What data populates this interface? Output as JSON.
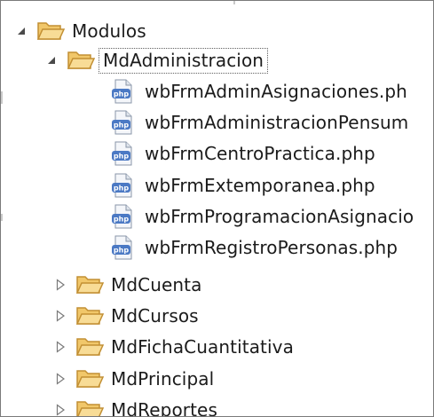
{
  "tree": {
    "root": {
      "label": "Modulos",
      "expanded": true,
      "icon": "folder-open-icon"
    },
    "selected": {
      "label": "MdAdministracion",
      "expanded": true,
      "icon": "folder-open-icon"
    },
    "files": [
      {
        "label": "wbFrmAdminAsignaciones.ph",
        "icon": "php-file-icon"
      },
      {
        "label": "wbFrmAdministracionPensum",
        "icon": "php-file-icon"
      },
      {
        "label": "wbFrmCentroPractica.php",
        "icon": "php-file-icon"
      },
      {
        "label": "wbFrmExtemporanea.php",
        "icon": "php-file-icon"
      },
      {
        "label": "wbFrmProgramacionAsignacio",
        "icon": "php-file-icon"
      },
      {
        "label": "wbFrmRegistroPersonas.php",
        "icon": "php-file-icon"
      }
    ],
    "folders": [
      {
        "label": "MdCuenta",
        "expanded": false,
        "icon": "folder-closed-icon"
      },
      {
        "label": "MdCursos",
        "expanded": false,
        "icon": "folder-closed-icon"
      },
      {
        "label": "MdFichaCuantitativa",
        "expanded": false,
        "icon": "folder-closed-icon"
      },
      {
        "label": "MdPrincipal",
        "expanded": false,
        "icon": "folder-closed-icon"
      },
      {
        "label": "MdReportes",
        "expanded": false,
        "icon": "folder-closed-icon"
      }
    ],
    "php_badge": "php"
  },
  "colors": {
    "folder_fill": "#f6d488",
    "folder_stroke": "#c9963a",
    "php_blue": "#4b79c4",
    "twisty": "#5a5a5a"
  }
}
